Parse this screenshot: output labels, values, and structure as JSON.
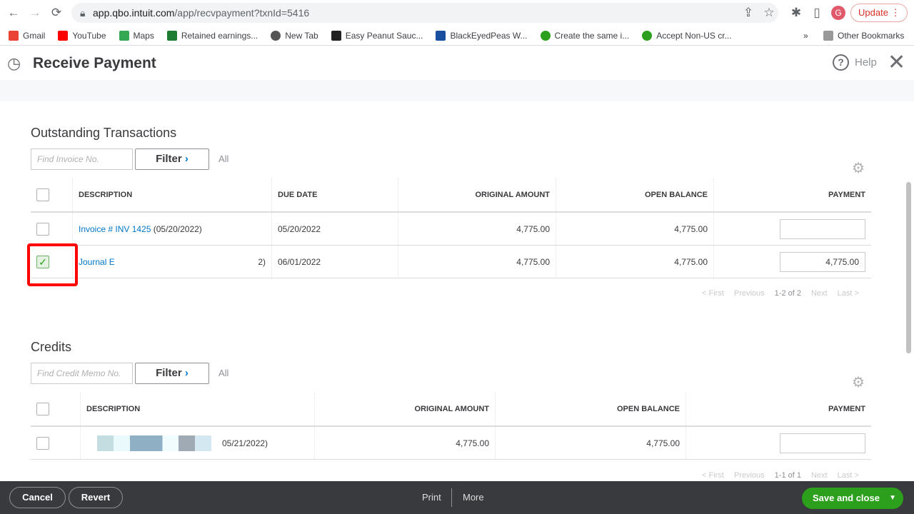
{
  "browser": {
    "url_host": "app.qbo.intuit.com",
    "url_path": "/app/recvpayment?txnId=5416",
    "update": "Update",
    "avatar": "G",
    "bookmarks": [
      "Gmail",
      "YouTube",
      "Maps",
      "Retained earnings...",
      "New Tab",
      "Easy Peanut Sauc...",
      "BlackEyedPeas W...",
      "Create the same i...",
      "Accept Non-US cr..."
    ],
    "more": "»",
    "other": "Other Bookmarks"
  },
  "header": {
    "title": "Receive Payment",
    "help": "Help"
  },
  "outstanding": {
    "title": "Outstanding Transactions",
    "search_placeholder": "Find Invoice No.",
    "filter": "Filter",
    "all": "All",
    "columns": [
      "DESCRIPTION",
      "DUE DATE",
      "ORIGINAL AMOUNT",
      "OPEN BALANCE",
      "PAYMENT"
    ],
    "rows": [
      {
        "desc_link": "Invoice # INV 1425",
        "desc_date": " (05/20/2022)",
        "due": "05/20/2022",
        "original": "4,775.00",
        "open": "4,775.00",
        "payment": "",
        "checked": false
      },
      {
        "desc_link": "Journal E",
        "desc_date": "2)",
        "due": "06/01/2022",
        "original": "4,775.00",
        "open": "4,775.00",
        "payment": "4,775.00",
        "checked": true
      }
    ],
    "pager": {
      "first": "< First",
      "previous": "Previous",
      "range": "1-2 of 2",
      "next": "Next",
      "last": "Last >"
    }
  },
  "credits": {
    "title": "Credits",
    "search_placeholder": "Find Credit Memo No.",
    "filter": "Filter",
    "all": "All",
    "columns": [
      "DESCRIPTION",
      "ORIGINAL AMOUNT",
      "OPEN BALANCE",
      "PAYMENT"
    ],
    "rows": [
      {
        "desc_date": "05/21/2022)",
        "original": "4,775.00",
        "open": "4,775.00",
        "payment": ""
      }
    ],
    "pager": {
      "first": "< First",
      "previous": "Previous",
      "range": "1-1 of 1",
      "next": "Next",
      "last": "Last >"
    }
  },
  "footer": {
    "cancel": "Cancel",
    "revert": "Revert",
    "print": "Print",
    "more": "More",
    "save": "Save and close"
  }
}
